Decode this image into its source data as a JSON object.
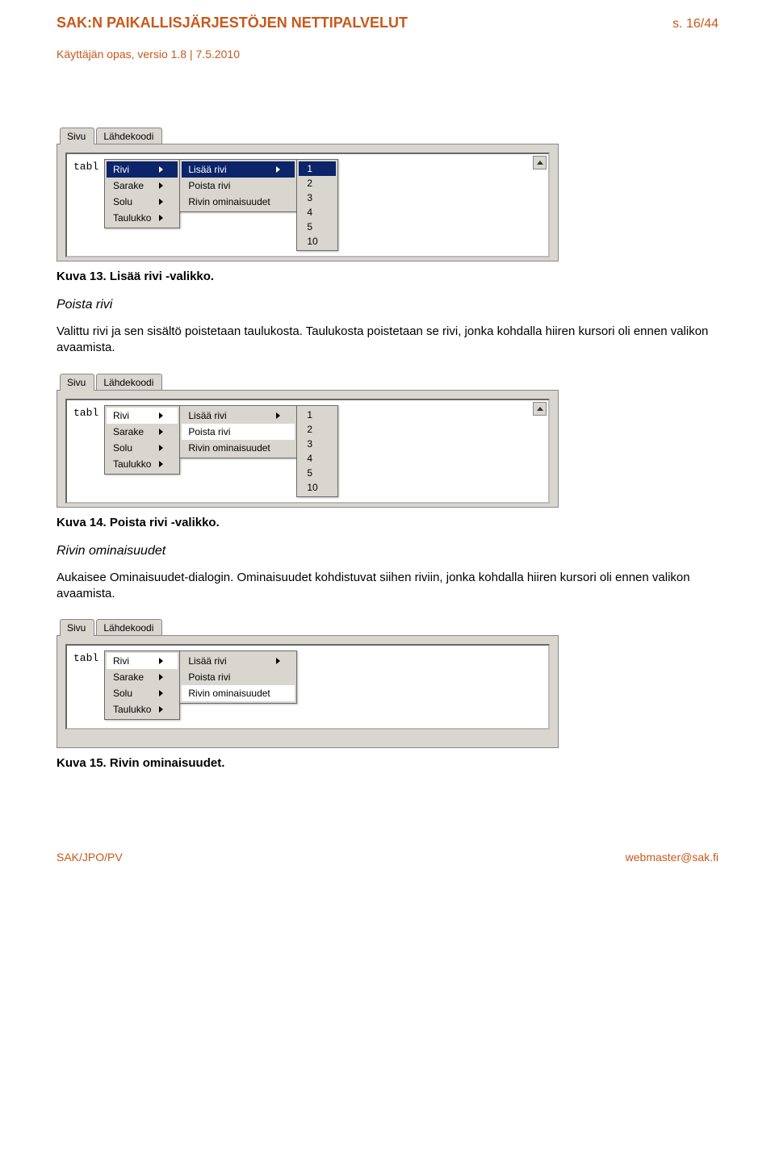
{
  "header": {
    "title": "SAK:N PAIKALLISJÄRJESTÖJEN NETTIPALVELUT",
    "page": "s. 16/44",
    "subtitle": "Käyttäjän opas, versio 1.8 | 7.5.2010"
  },
  "tabs": {
    "sivu": "Sivu",
    "lahde": "Lähdekoodi"
  },
  "editor_text": "tabl",
  "menu1_labels": {
    "rivi": "Rivi",
    "sarake": "Sarake",
    "solu": "Solu",
    "taulukko": "Taulukko"
  },
  "menu2_labels": {
    "lisaa": "Lisää rivi",
    "poista": "Poista rivi",
    "omin": "Rivin ominaisuudet"
  },
  "menu3_nums": [
    "1",
    "2",
    "3",
    "4",
    "5",
    "10"
  ],
  "fig1_caption_bold": "Kuva 13. Lisää rivi -valikko.",
  "sec1_title": "Poista rivi",
  "sec1_para": "Valittu rivi ja sen sisältö poistetaan taulukosta. Taulukosta poistetaan se rivi, jonka kohdalla hiiren kursori oli ennen valikon avaamista.",
  "fig2_caption_bold": "Kuva 14. Poista rivi -valikko.",
  "sec2_title": "Rivin ominaisuudet",
  "sec2_para": "Aukaisee Ominaisuudet-dialogin. Ominaisuudet kohdistuvat siihen riviin, jonka kohdalla hiiren kursori oli ennen valikon avaamista.",
  "fig3_caption_bold": "Kuva 15. Rivin ominaisuudet.",
  "footer": {
    "left": "SAK/JPO/PV",
    "right": "webmaster@sak.fi"
  }
}
